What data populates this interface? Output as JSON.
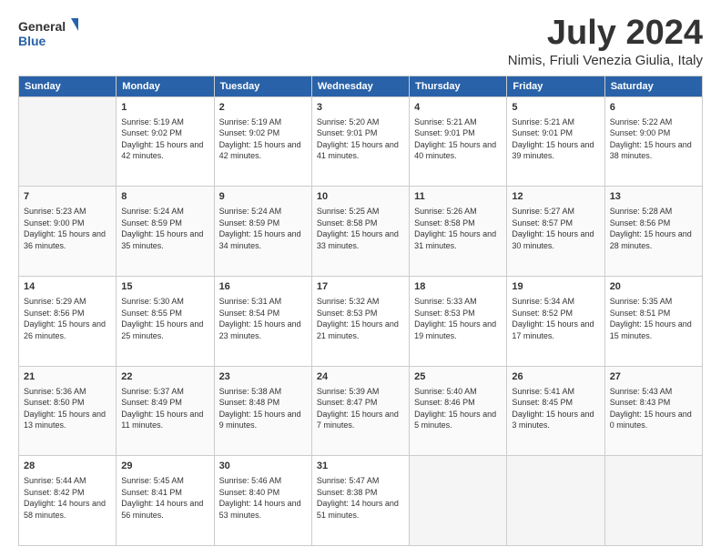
{
  "logo": {
    "line1": "General",
    "line2": "Blue"
  },
  "title": "July 2024",
  "subtitle": "Nimis, Friuli Venezia Giulia, Italy",
  "days_of_week": [
    "Sunday",
    "Monday",
    "Tuesday",
    "Wednesday",
    "Thursday",
    "Friday",
    "Saturday"
  ],
  "weeks": [
    [
      {
        "day": "",
        "empty": true
      },
      {
        "day": "1",
        "sunrise": "5:19 AM",
        "sunset": "9:02 PM",
        "daylight": "15 hours and 42 minutes."
      },
      {
        "day": "2",
        "sunrise": "5:19 AM",
        "sunset": "9:02 PM",
        "daylight": "15 hours and 42 minutes."
      },
      {
        "day": "3",
        "sunrise": "5:20 AM",
        "sunset": "9:01 PM",
        "daylight": "15 hours and 41 minutes."
      },
      {
        "day": "4",
        "sunrise": "5:21 AM",
        "sunset": "9:01 PM",
        "daylight": "15 hours and 40 minutes."
      },
      {
        "day": "5",
        "sunrise": "5:21 AM",
        "sunset": "9:01 PM",
        "daylight": "15 hours and 39 minutes."
      },
      {
        "day": "6",
        "sunrise": "5:22 AM",
        "sunset": "9:00 PM",
        "daylight": "15 hours and 38 minutes."
      }
    ],
    [
      {
        "day": "7",
        "sunrise": "5:23 AM",
        "sunset": "9:00 PM",
        "daylight": "15 hours and 36 minutes."
      },
      {
        "day": "8",
        "sunrise": "5:24 AM",
        "sunset": "8:59 PM",
        "daylight": "15 hours and 35 minutes."
      },
      {
        "day": "9",
        "sunrise": "5:24 AM",
        "sunset": "8:59 PM",
        "daylight": "15 hours and 34 minutes."
      },
      {
        "day": "10",
        "sunrise": "5:25 AM",
        "sunset": "8:58 PM",
        "daylight": "15 hours and 33 minutes."
      },
      {
        "day": "11",
        "sunrise": "5:26 AM",
        "sunset": "8:58 PM",
        "daylight": "15 hours and 31 minutes."
      },
      {
        "day": "12",
        "sunrise": "5:27 AM",
        "sunset": "8:57 PM",
        "daylight": "15 hours and 30 minutes."
      },
      {
        "day": "13",
        "sunrise": "5:28 AM",
        "sunset": "8:56 PM",
        "daylight": "15 hours and 28 minutes."
      }
    ],
    [
      {
        "day": "14",
        "sunrise": "5:29 AM",
        "sunset": "8:56 PM",
        "daylight": "15 hours and 26 minutes."
      },
      {
        "day": "15",
        "sunrise": "5:30 AM",
        "sunset": "8:55 PM",
        "daylight": "15 hours and 25 minutes."
      },
      {
        "day": "16",
        "sunrise": "5:31 AM",
        "sunset": "8:54 PM",
        "daylight": "15 hours and 23 minutes."
      },
      {
        "day": "17",
        "sunrise": "5:32 AM",
        "sunset": "8:53 PM",
        "daylight": "15 hours and 21 minutes."
      },
      {
        "day": "18",
        "sunrise": "5:33 AM",
        "sunset": "8:53 PM",
        "daylight": "15 hours and 19 minutes."
      },
      {
        "day": "19",
        "sunrise": "5:34 AM",
        "sunset": "8:52 PM",
        "daylight": "15 hours and 17 minutes."
      },
      {
        "day": "20",
        "sunrise": "5:35 AM",
        "sunset": "8:51 PM",
        "daylight": "15 hours and 15 minutes."
      }
    ],
    [
      {
        "day": "21",
        "sunrise": "5:36 AM",
        "sunset": "8:50 PM",
        "daylight": "15 hours and 13 minutes."
      },
      {
        "day": "22",
        "sunrise": "5:37 AM",
        "sunset": "8:49 PM",
        "daylight": "15 hours and 11 minutes."
      },
      {
        "day": "23",
        "sunrise": "5:38 AM",
        "sunset": "8:48 PM",
        "daylight": "15 hours and 9 minutes."
      },
      {
        "day": "24",
        "sunrise": "5:39 AM",
        "sunset": "8:47 PM",
        "daylight": "15 hours and 7 minutes."
      },
      {
        "day": "25",
        "sunrise": "5:40 AM",
        "sunset": "8:46 PM",
        "daylight": "15 hours and 5 minutes."
      },
      {
        "day": "26",
        "sunrise": "5:41 AM",
        "sunset": "8:45 PM",
        "daylight": "15 hours and 3 minutes."
      },
      {
        "day": "27",
        "sunrise": "5:43 AM",
        "sunset": "8:43 PM",
        "daylight": "15 hours and 0 minutes."
      }
    ],
    [
      {
        "day": "28",
        "sunrise": "5:44 AM",
        "sunset": "8:42 PM",
        "daylight": "14 hours and 58 minutes."
      },
      {
        "day": "29",
        "sunrise": "5:45 AM",
        "sunset": "8:41 PM",
        "daylight": "14 hours and 56 minutes."
      },
      {
        "day": "30",
        "sunrise": "5:46 AM",
        "sunset": "8:40 PM",
        "daylight": "14 hours and 53 minutes."
      },
      {
        "day": "31",
        "sunrise": "5:47 AM",
        "sunset": "8:38 PM",
        "daylight": "14 hours and 51 minutes."
      },
      {
        "day": "",
        "empty": true
      },
      {
        "day": "",
        "empty": true
      },
      {
        "day": "",
        "empty": true
      }
    ]
  ]
}
